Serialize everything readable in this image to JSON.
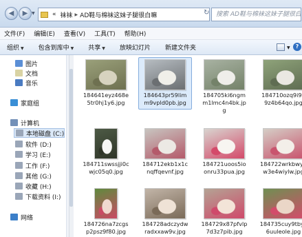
{
  "address": {
    "crumbs": [
      "«",
      "袜袜",
      "AD鞋与棉袜这妹子腿很白嘛"
    ],
    "search_placeholder": "搜索 AD鞋与棉袜这妹子腿很白嘛"
  },
  "menu": [
    "文件(F)",
    "编辑(E)",
    "查看(V)",
    "工具(T)",
    "帮助(H)"
  ],
  "toolbar": [
    "组织",
    "包含到库中",
    "共享",
    "放映幻灯片",
    "新建文件夹"
  ],
  "nav": {
    "items": [
      {
        "label": "图片",
        "icon": "pictures-icon",
        "color": "#5b8fd6"
      },
      {
        "label": "文档",
        "icon": "documents-icon",
        "color": "#d9d3a4"
      },
      {
        "label": "音乐",
        "icon": "music-icon",
        "color": "#4a7bc1"
      },
      {
        "label": "家庭组",
        "icon": "homegroup-icon",
        "color": "#3a8fd6"
      },
      {
        "label": "计算机",
        "icon": "computer-icon",
        "color": "#7390b8"
      },
      {
        "label": "本地磁盘 (C:)",
        "icon": "drive-icon",
        "color": "#9aa6b8"
      },
      {
        "label": "软件 (D:)",
        "icon": "drive-icon",
        "color": "#9aa6b8"
      },
      {
        "label": "学习 (E:)",
        "icon": "drive-icon",
        "color": "#9aa6b8"
      },
      {
        "label": "工作 (F:)",
        "icon": "drive-icon",
        "color": "#9aa6b8"
      },
      {
        "label": "其他 (G:)",
        "icon": "drive-icon",
        "color": "#9aa6b8"
      },
      {
        "label": "收藏 (H:)",
        "icon": "drive-icon",
        "color": "#9aa6b8"
      },
      {
        "label": "下载资料 (I:)",
        "icon": "drive-icon",
        "color": "#9aa6b8"
      },
      {
        "label": "网络",
        "icon": "network-icon",
        "color": "#3c7fc9"
      }
    ],
    "selected_index": 5
  },
  "files": [
    {
      "name1": "184641eyz468e",
      "name2": "5tr0hj1y6.jpg",
      "colors": [
        "#9aa07a",
        "#d7d3bf",
        "#6e7050"
      ]
    },
    {
      "name1": "184643pr59lim",
      "name2": "m9vpld0pb.jpg",
      "colors": [
        "#b6bcc1",
        "#f0efe9",
        "#6b6f72"
      ]
    },
    {
      "name1": "184705ki6ngm",
      "name2": "m1lmc4n4bk.jp",
      "name3": "g",
      "colors": [
        "#a8b2a2",
        "#efeeea",
        "#748269"
      ]
    },
    {
      "name1": "184710ozq9i94",
      "name2": "9z4b64qo.jpg",
      "colors": [
        "#8fa37a",
        "#eae8e2",
        "#5f6d52"
      ]
    },
    {
      "name1": "184711swssjji0c",
      "name2": "wjc05q0.jpg",
      "colors": [
        "#4d5a45",
        "#f6f6f4",
        "#2f3528"
      ]
    },
    {
      "name1": "184712ekb1x1c",
      "name2": "nqffqevnf.jpg",
      "colors": [
        "#c8c5c0",
        "#ece9e4",
        "#b45a6a"
      ]
    },
    {
      "name1": "184721uoos5io",
      "name2": "onru33pua.jpg",
      "colors": [
        "#d8d4cf",
        "#f7f5f1",
        "#d44a6a"
      ]
    },
    {
      "name1": "184722wrkbwyn",
      "name2": "w3e4wiylw.jpg",
      "colors": [
        "#d5cec6",
        "#f3efe9",
        "#c9546e"
      ]
    },
    {
      "name1": "184726na7zcgs",
      "name2": "p2psz9f80.jpg",
      "colors": [
        "#5f8a3d",
        "#f0d9cf",
        "#c94b64"
      ]
    },
    {
      "name1": "184728adczydw",
      "name2": "radxxaw9v.jpg",
      "colors": [
        "#c2b5a8",
        "#efe2d6",
        "#7a6a58"
      ]
    },
    {
      "name1": "184729x87pfvlp",
      "name2": "7d3z7pib.jpg",
      "colors": [
        "#b4a394",
        "#f3e4d8",
        "#cf4a6b"
      ]
    },
    {
      "name1": "184735cuy9tbyc",
      "name2": "6uuleole.jpg",
      "colors": [
        "#6f8f52",
        "#ead6c7",
        "#d24c6a"
      ]
    }
  ],
  "selected_file_index": 1
}
